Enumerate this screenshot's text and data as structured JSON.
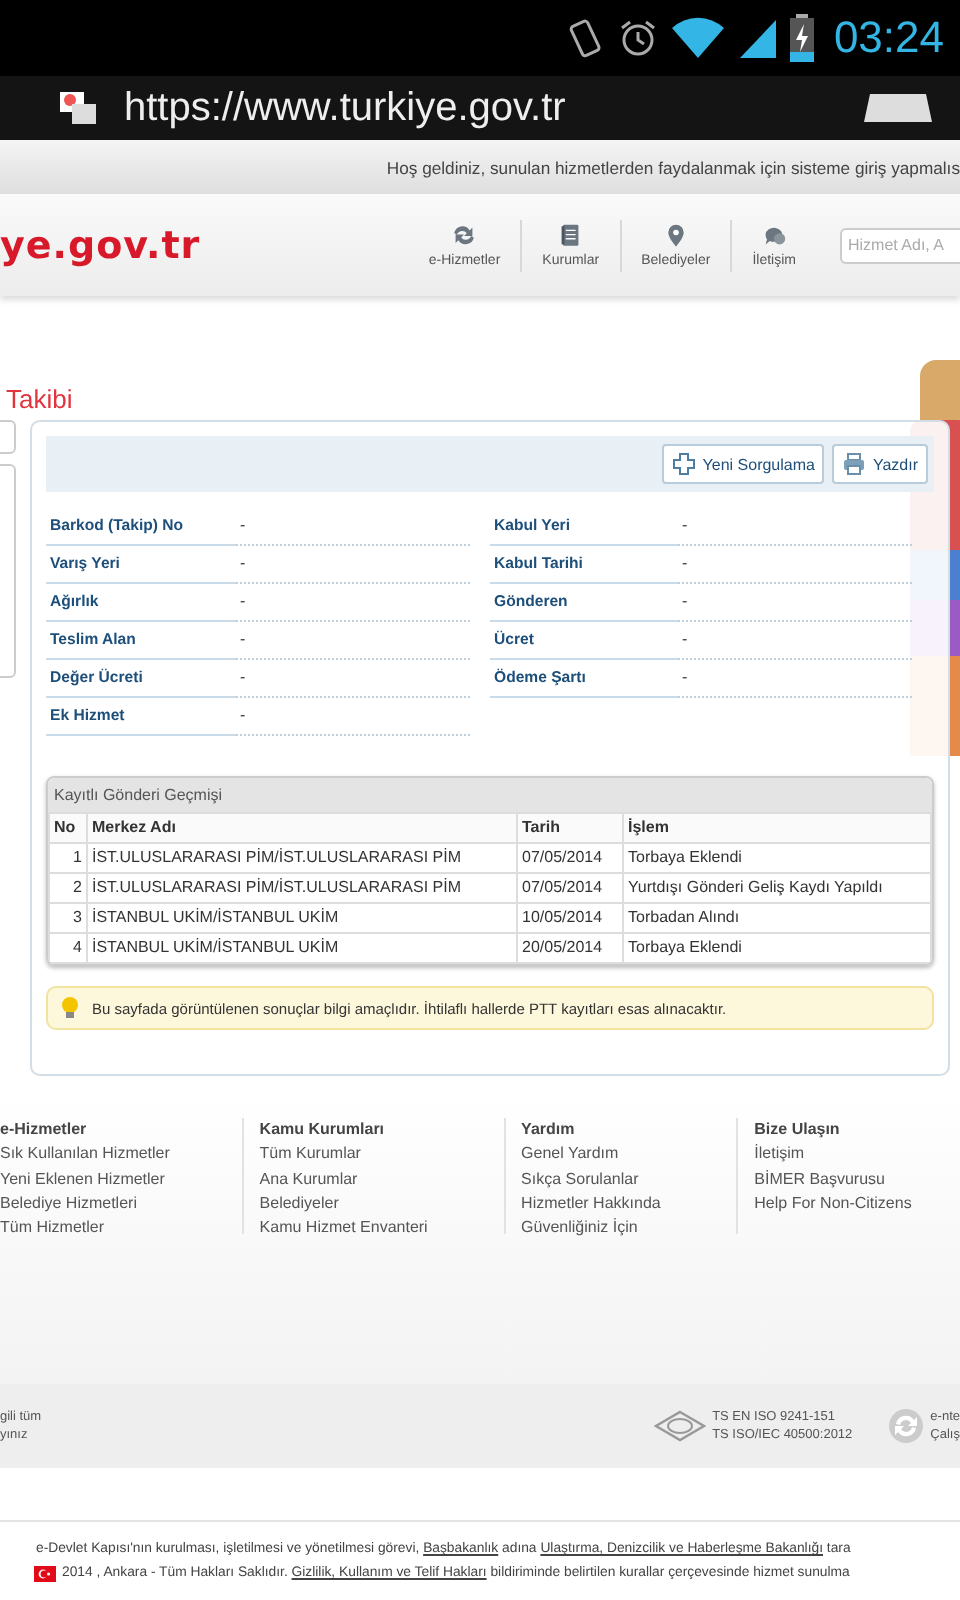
{
  "status_bar": {
    "time": "03:24"
  },
  "address_bar": {
    "url": "https://www.turkiye.gov.tr"
  },
  "welcome_text": "Hoş geldiniz, sunulan hizmetlerden faydalanmak için sisteme giriş yapmalıs",
  "header": {
    "logo": "ye.gov.tr",
    "nav": [
      {
        "label": "e-Hizmetler",
        "kind": "refresh"
      },
      {
        "label": "Kurumlar",
        "kind": "book"
      },
      {
        "label": "Belediyeler",
        "kind": "pin"
      },
      {
        "label": "İletişim",
        "kind": "chat"
      }
    ],
    "search": {
      "placeholder": "Hizmet Adı, A"
    }
  },
  "page_title": "Takibi",
  "toolbar": {
    "buttons": [
      {
        "label": "Yeni Sorgulama",
        "kind": "plus"
      },
      {
        "label": "Yazdır",
        "kind": "print"
      }
    ]
  },
  "fields": [
    {
      "label": "Barkod (Takip) No",
      "value": "-"
    },
    {
      "label": "Kabul Yeri",
      "value": "-"
    },
    {
      "label": "Varış Yeri",
      "value": "-"
    },
    {
      "label": "Kabul Tarihi",
      "value": "-"
    },
    {
      "label": "Ağırlık",
      "value": "-"
    },
    {
      "label": "Gönderen",
      "value": "-"
    },
    {
      "label": "Teslim Alan",
      "value": "-"
    },
    {
      "label": "Ücret",
      "value": "-"
    },
    {
      "label": "Değer Ücreti",
      "value": "-"
    },
    {
      "label": "Ödeme Şartı",
      "value": "-"
    },
    {
      "label": "Ek Hizmet",
      "value": "-"
    }
  ],
  "history": {
    "title": "Kayıtlı Gönderi Geçmişi",
    "columns": [
      "No",
      "Merkez Adı",
      "Tarih",
      "İşlem"
    ],
    "rows": [
      [
        "1",
        "İST.ULUSLARARASI PİM/İST.ULUSLARARASI PİM",
        "07/05/2014",
        "Torbaya Eklendi"
      ],
      [
        "2",
        "İST.ULUSLARARASI PİM/İST.ULUSLARARASI PİM",
        "07/05/2014",
        "Yurtdışı Gönderi Geliş Kaydı Yapıldı"
      ],
      [
        "3",
        "İSTANBUL UKİM/İSTANBUL UKİM",
        "10/05/2014",
        "Torbadan Alındı"
      ],
      [
        "4",
        "İSTANBUL UKİM/İSTANBUL UKİM",
        "20/05/2014",
        "Torbaya Eklendi"
      ]
    ]
  },
  "notice": "Bu sayfada görüntülenen sonuçlar bilgi amaçlıdır. İhtilaflı hallerde PTT kayıtları esas alınacaktır.",
  "footer": {
    "columns": [
      {
        "title": "e-Hizmetler",
        "links": [
          "Sık Kullanılan Hizmetler",
          "Yeni Eklenen Hizmetler",
          "Belediye Hizmetleri",
          "Tüm Hizmetler"
        ]
      },
      {
        "title": "Kamu Kurumları",
        "links": [
          "Tüm Kurumlar",
          "Ana Kurumlar",
          "Belediyeler",
          "Kamu Hizmet Envanteri"
        ]
      },
      {
        "title": "Yardım",
        "links": [
          "Genel Yardım",
          "Sıkça Sorulanlar",
          "Hizmetler Hakkında",
          "Güvenliğiniz İçin"
        ]
      },
      {
        "title": "Bize Ulaşın",
        "links": [
          "İletişim",
          "BİMER Başvurusu",
          "Help For Non-Citizens"
        ]
      }
    ]
  },
  "footer_band": {
    "left_lines": [
      "gili tüm",
      "yınız"
    ],
    "certifications": [
      "TS EN ISO 9241-151",
      "TS ISO/IEC 40500:2012"
    ],
    "right_lines": [
      "e-nte",
      "Çalış"
    ]
  },
  "copyright": [
    [
      {
        "text": "e-Devlet Kapısı'nın kurulması, işletilmesi ve yönetilmesi görevi, "
      },
      {
        "text": "Başbakanlık",
        "link": true
      },
      {
        "text": " adına "
      },
      {
        "text": "Ulaştırma, Denizcilik ve Haberleşme Bakanlığı",
        "link": true
      },
      {
        "text": " tara"
      }
    ],
    [
      {
        "text": "2014 , Ankara - Tüm Hakları Saklıdır. "
      },
      {
        "text": "Gizlilik, Kullanım ve Telif Hakları",
        "link": true
      },
      {
        "text": " bildiriminde belirtilen kurallar çerçevesinde hizmet sunulma"
      }
    ]
  ]
}
